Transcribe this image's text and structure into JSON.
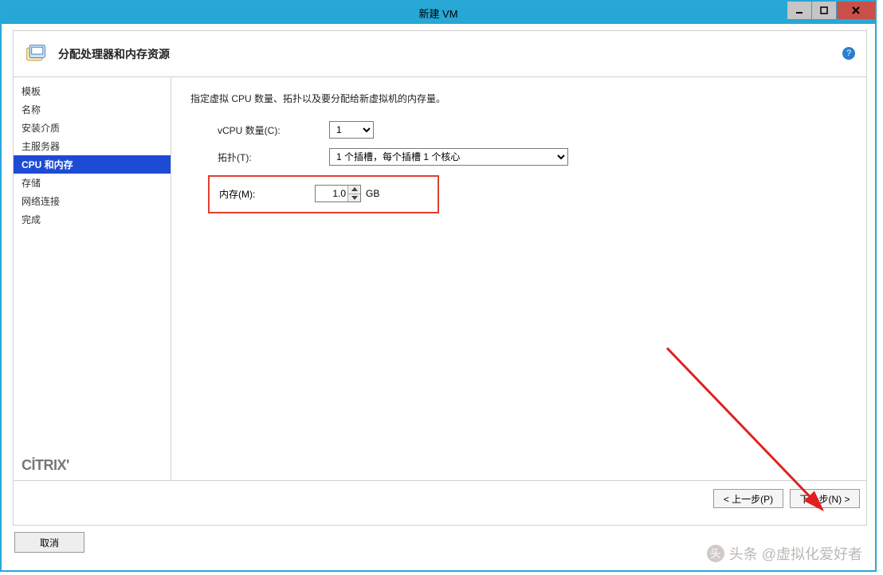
{
  "window": {
    "title": "新建 VM"
  },
  "header": {
    "title": "分配处理器和内存资源"
  },
  "sidebar": {
    "items": [
      {
        "label": "模板"
      },
      {
        "label": "名称"
      },
      {
        "label": "安装介质"
      },
      {
        "label": "主服务器"
      },
      {
        "label": "CPU 和内存"
      },
      {
        "label": "存储"
      },
      {
        "label": "网络连接"
      },
      {
        "label": "完成"
      }
    ],
    "brand": "CİTRIX'"
  },
  "main": {
    "description": "指定虚拟 CPU 数量、拓扑以及要分配给新虚拟机的内存量。",
    "vcpu_label": "vCPU 数量(C):",
    "vcpu_value": "1",
    "topology_label": "拓扑(T):",
    "topology_value": "1 个插槽，每个插槽 1 个核心",
    "memory_label": "内存(M):",
    "memory_value": "1.0",
    "memory_unit": "GB"
  },
  "footer": {
    "prev": "< 上一步(P)",
    "next": "下一步(N) >",
    "cancel": "取消"
  },
  "watermark": {
    "text": "头条 @虚拟化爱好者"
  }
}
